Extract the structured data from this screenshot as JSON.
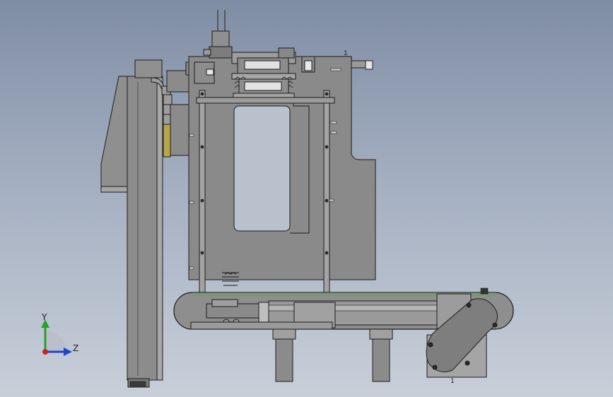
{
  "view": {
    "background_top": "#7f8da4",
    "background_bottom": "#c8cfd9",
    "part_fill": "#8a8a8a",
    "part_light": "#a9a9a9",
    "part_dark": "#6e6e6e",
    "edge": "#1c1c1c"
  },
  "triad": {
    "y_label": "Y",
    "z_label": "Z",
    "y_color": "#2aa02a",
    "z_color": "#2244cc",
    "x_color": "#cc2222"
  },
  "annotations": {
    "marker_top": "1",
    "marker_bottom": "1"
  }
}
